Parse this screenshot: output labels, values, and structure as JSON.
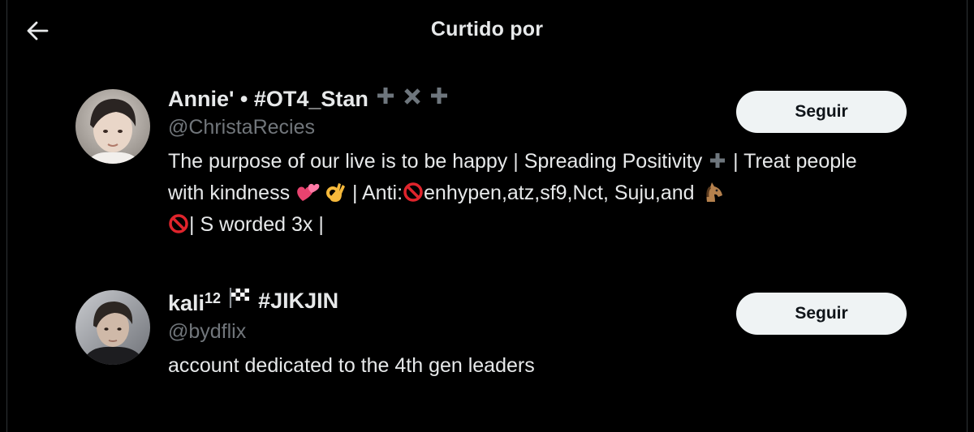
{
  "header": {
    "title": "Curtido por",
    "back_icon": "arrow-left-icon"
  },
  "users": [
    {
      "display_name": "Annie' • #OT4_Stan",
      "name_symbols": [
        "plus-icon",
        "cross-icon",
        "plus-icon"
      ],
      "handle": "@ChristaRecies",
      "bio_part_1": "The purpose of our live is to be happy | Spreading Positivity",
      "bio_part_2": "| Treat people with kindness",
      "bio_part_3": "| Anti:",
      "bio_part_4": "enhypen,atz,sf9,Nct, Suju,and",
      "bio_part_5": "| S worded 3x |",
      "bio_emojis": [
        "plus-icon",
        "two-hearts-emoji",
        "ok-hand-emoji",
        "prohibited-emoji",
        "horse-emoji",
        "prohibited-emoji"
      ],
      "follow_label": "Seguir"
    },
    {
      "display_name_main": "kali",
      "display_name_sup": "12",
      "display_name_tag": "#JIKJIN",
      "name_symbols": [
        "checkered-flag-emoji"
      ],
      "handle": "@bydflix",
      "bio": "account dedicated to the 4th gen leaders",
      "follow_label": "Seguir"
    }
  ],
  "colors": {
    "background": "#000000",
    "primary_text": "#e7e9ea",
    "secondary_text": "#71767b",
    "button_bg": "#eff3f4",
    "button_text": "#0f1419",
    "symbol_gray": "#6e767d"
  }
}
